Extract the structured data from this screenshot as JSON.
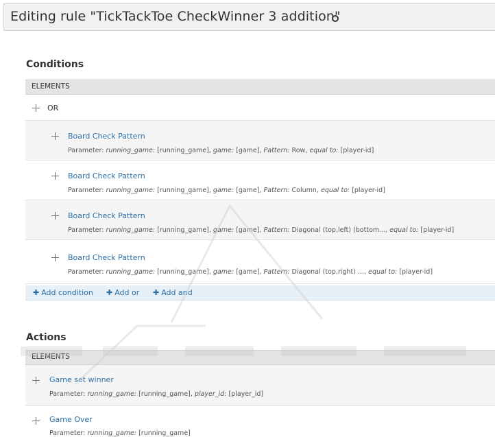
{
  "header": {
    "title": "Editing rule \"TickTackToe CheckWinner 3 addition\"",
    "settings_icon": "gear-icon"
  },
  "conditions": {
    "section_title": "Conditions",
    "column_header": "ELEMENTS",
    "or_label": "OR",
    "items": [
      {
        "name": "Board Check Pattern",
        "param_prefix": "Parameter:",
        "p1_key": "running_game:",
        "p1_val": "[running_game],",
        "p2_key": "game:",
        "p2_val": "[game],",
        "p3_key": "Pattern:",
        "p3_val": "Row,",
        "p4_key": "equal to:",
        "p4_val": "[player-id]"
      },
      {
        "name": "Board Check Pattern",
        "param_prefix": "Parameter:",
        "p1_key": "running_game:",
        "p1_val": "[running_game],",
        "p2_key": "game:",
        "p2_val": "[game],",
        "p3_key": "Pattern:",
        "p3_val": "Column,",
        "p4_key": "equal to:",
        "p4_val": "[player-id]"
      },
      {
        "name": "Board Check Pattern",
        "param_prefix": "Parameter:",
        "p1_key": "running_game:",
        "p1_val": "[running_game],",
        "p2_key": "game:",
        "p2_val": "[game],",
        "p3_key": "Pattern:",
        "p3_val": "Diagonal (top,left) (bottom...,",
        "p4_key": "equal to:",
        "p4_val": "[player-id]"
      },
      {
        "name": "Board Check Pattern",
        "param_prefix": "Parameter:",
        "p1_key": "running_game:",
        "p1_val": "[running_game],",
        "p2_key": "game:",
        "p2_val": "[game],",
        "p3_key": "Pattern:",
        "p3_val": "Diagonal (top,right) ...,",
        "p4_key": "equal to:",
        "p4_val": "[player-id]"
      }
    ],
    "add_links": {
      "add_condition": "Add condition",
      "add_or": "Add or",
      "add_and": "Add and"
    }
  },
  "actions": {
    "section_title": "Actions",
    "column_header": "ELEMENTS",
    "items": [
      {
        "name": "Game set winner",
        "param_prefix": "Parameter:",
        "p1_key": "running_game:",
        "p1_val": "[running_game],",
        "p2_key": "player_id:",
        "p2_val": "[player_id]"
      },
      {
        "name": "Game Over",
        "param_prefix": "Parameter:",
        "p1_key": "running_game:",
        "p1_val": "[running_game]"
      }
    ]
  },
  "colors": {
    "link": "#2a6fa8",
    "header_bg": "#e4e4e4",
    "add_bar_bg": "#e7f0f7"
  }
}
